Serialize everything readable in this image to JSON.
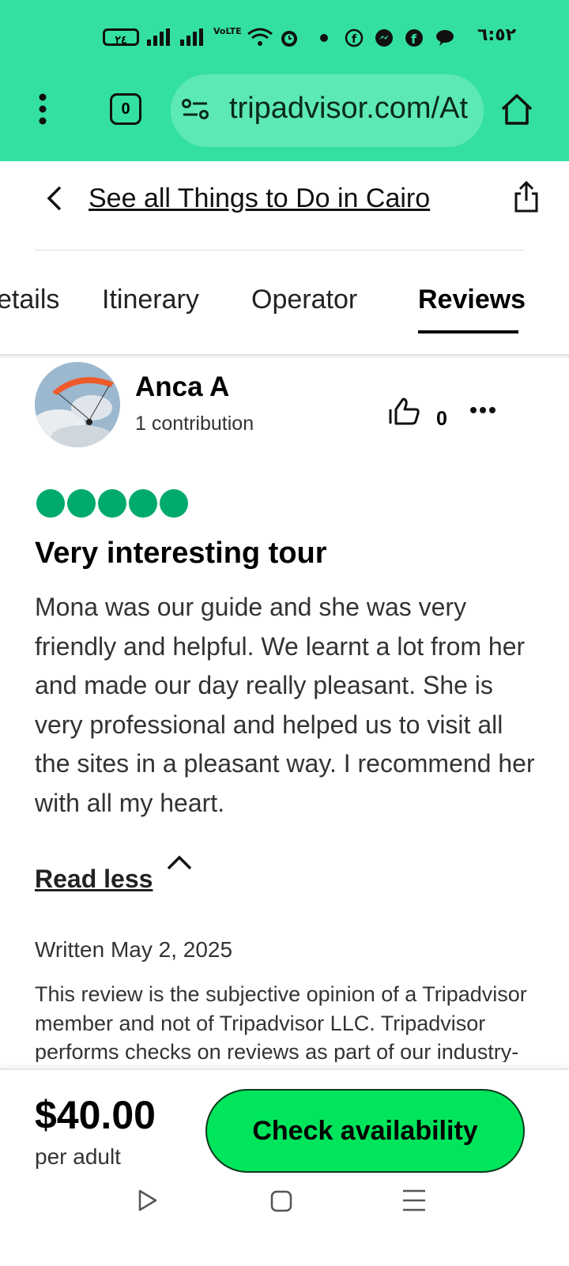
{
  "status_bar": {
    "time": "٦:٥٢",
    "battery": "٢٤",
    "network_label": "VoLTE"
  },
  "browser": {
    "url": "tripadvisor.com/At",
    "tab_count": "0"
  },
  "header": {
    "back_link": "See all Things to Do in Cairo"
  },
  "tabs": [
    {
      "label": "etails"
    },
    {
      "label": "Itinerary"
    },
    {
      "label": "Operator"
    },
    {
      "label": "Reviews",
      "active": true
    }
  ],
  "review": {
    "user_name": "Anca A",
    "contributions": "1 contribution",
    "helpful_votes": "0",
    "rating": 5,
    "rating_color": "#00aa6c",
    "title": "Very interesting tour",
    "body": "Mona was our guide and she was very friendly and helpful. We learnt a lot from her and made our day really pleasant. She is very professional and helped us to visit all the sites in a pleasant way. I recommend her with all my heart.",
    "read_less": "Read less",
    "written": "Written May 2, 2025",
    "disclaimer": "This review is the subjective opinion of a Tripadvisor member and not of Tripadvisor LLC. Tripadvisor performs checks on reviews as part of our industry-leading trust"
  },
  "booking": {
    "price": "$40.00",
    "unit": "per adult",
    "cta": "Check availability",
    "cta_color": "#00e55c"
  },
  "colors": {
    "brand_green": "#34e0a1"
  }
}
